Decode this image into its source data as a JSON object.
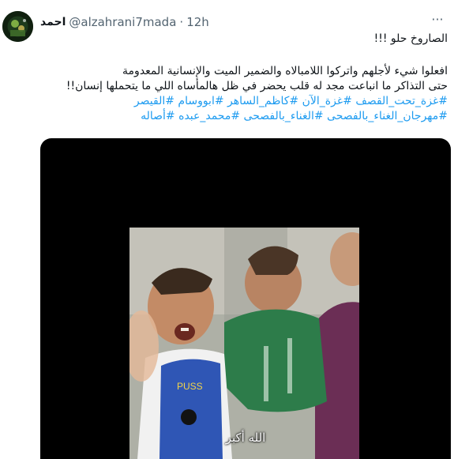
{
  "author": {
    "display_name": "احمد",
    "handle": "@alzahrani7mada",
    "separator": "·",
    "time": "12h",
    "avatar_icon": "avatar-image"
  },
  "actions": {
    "more_icon": "more-options-icon",
    "more_label": "···"
  },
  "tweet": {
    "line1": "الصاروخ حلو !!!",
    "line2": "افعلوا شيء لأجلهم واتركوا اللامبالاه والضمير الميت والإنسانية المعدومة",
    "line3": "حتى التذاكر ما انباعت مجد له قلب يحضر في ظل هالمأساه اللي ما يتحملها إنسان!!",
    "hashtags_line1": "#غزة_تحت_القصف #غزة_الآن #كاظم_الساهر #ابووسام #القيصر",
    "hashtags_line2": "#مهرجان_الغناء_بالفصحى #الغناء_بالفصحى #محمد_عبده #أصاله"
  },
  "media": {
    "caption": "الله أكبر",
    "background": "#000000"
  },
  "colors": {
    "link": "#1d9bf0",
    "text": "#0f1419",
    "muted": "#536471"
  }
}
